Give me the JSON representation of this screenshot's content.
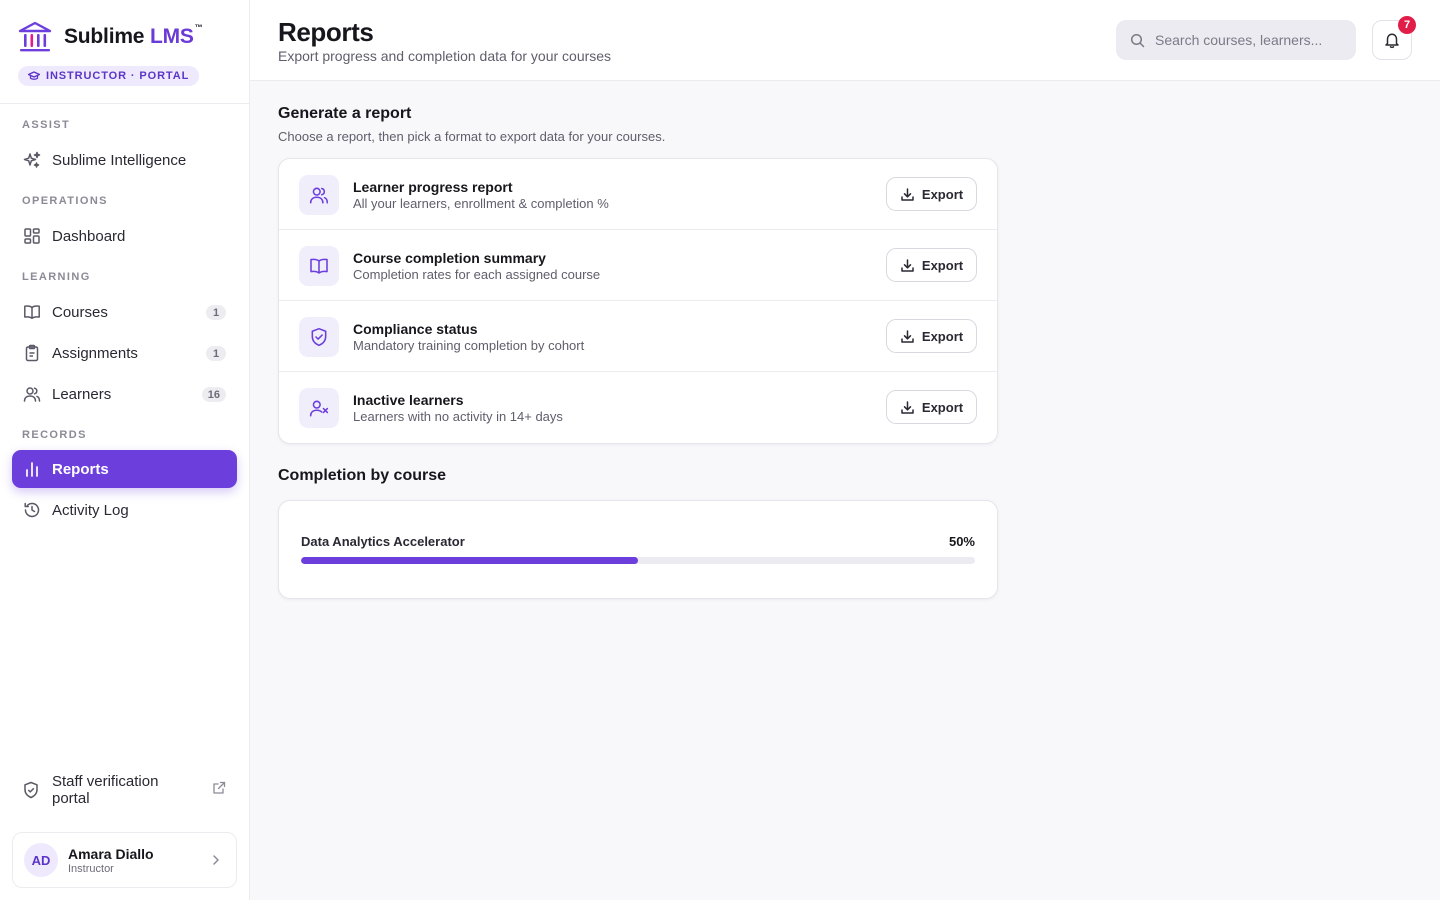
{
  "brand": {
    "name_main": "Sublime",
    "name_accent": "LMS",
    "trademark": "™",
    "portal_badge": "INSTRUCTOR · PORTAL",
    "accent_color": "#6c3fdd"
  },
  "sidebar": {
    "sections": [
      {
        "label": "ASSIST",
        "items": [
          {
            "label": "Sublime Intelligence",
            "icon": "sparkles-icon"
          }
        ]
      },
      {
        "label": "OPERATIONS",
        "items": [
          {
            "label": "Dashboard",
            "icon": "dashboard-grid-icon"
          }
        ]
      },
      {
        "label": "LEARNING",
        "items": [
          {
            "label": "Courses",
            "icon": "book-icon",
            "count": "1"
          },
          {
            "label": "Assignments",
            "icon": "clipboard-icon",
            "count": "1"
          },
          {
            "label": "Learners",
            "icon": "users-icon",
            "count": "16"
          }
        ]
      },
      {
        "label": "RECORDS",
        "items": [
          {
            "label": "Reports",
            "icon": "bar-chart-icon",
            "active": true
          },
          {
            "label": "Activity Log",
            "icon": "history-icon"
          }
        ]
      }
    ],
    "staff_link": {
      "label": "Staff verification portal",
      "icon": "shield-check-icon"
    },
    "user": {
      "initials": "AD",
      "name": "Amara Diallo",
      "role": "Instructor"
    }
  },
  "header": {
    "title": "Reports",
    "subtitle": "Export progress and completion data for your courses",
    "search_placeholder": "Search courses, learners...",
    "notification_count": "7"
  },
  "generate": {
    "heading": "Generate a report",
    "subheading": "Choose a report, then pick a format to export data for your courses.",
    "export_label": "Export",
    "reports": [
      {
        "title": "Learner progress report",
        "description": "All your learners, enrollment & completion %",
        "icon": "users-icon"
      },
      {
        "title": "Course completion summary",
        "description": "Completion rates for each assigned course",
        "icon": "book-open-icon"
      },
      {
        "title": "Compliance status",
        "description": "Mandatory training completion by cohort",
        "icon": "shield-check-icon"
      },
      {
        "title": "Inactive learners",
        "description": "Learners with no activity in 14+ days",
        "icon": "user-x-icon"
      }
    ]
  },
  "completion": {
    "heading": "Completion by course",
    "courses": [
      {
        "name": "Data Analytics Accelerator",
        "percent_label": "50%",
        "percent": 50
      }
    ]
  }
}
